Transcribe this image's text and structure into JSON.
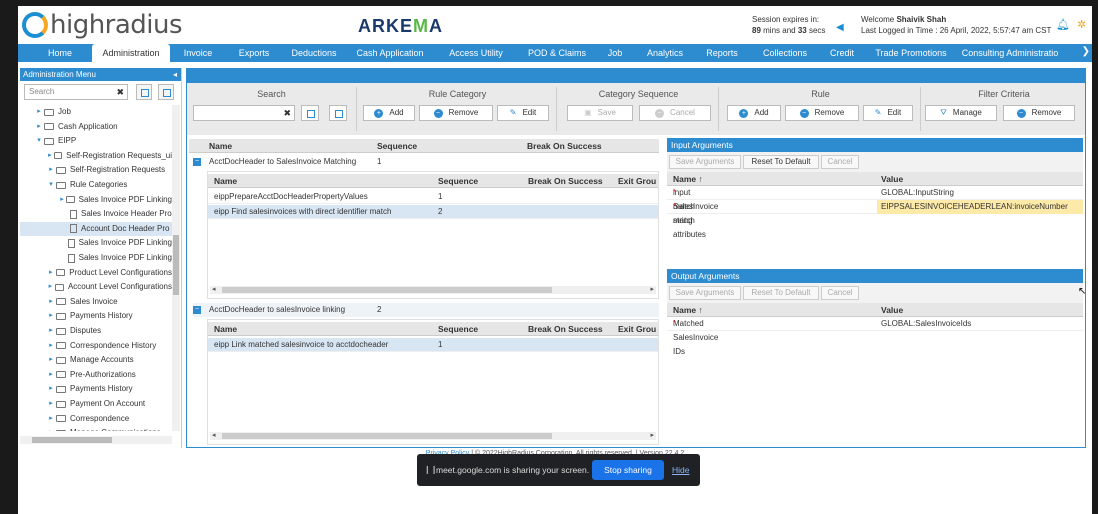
{
  "header": {
    "logo_text": "highradius",
    "brand": "ARKEMA",
    "session_label": "Session expires in:",
    "session_mins": "89",
    "session_mins_label": "mins and",
    "session_secs": "33",
    "session_secs_label": "secs",
    "welcome_label": "Welcome",
    "user_name": "Shaivik Shah",
    "last_logged": "Last Logged in Time : 26 April, 2022, 5:57:47 am CST"
  },
  "nav": {
    "tabs": [
      "Home",
      "Administration",
      "Invoice",
      "Exports",
      "Deductions",
      "Cash Application",
      "Access Utility",
      "POD & Claims",
      "Job",
      "Analytics",
      "Reports",
      "Collections",
      "Credit",
      "Trade Promotions",
      "Consulting Administratio"
    ],
    "active": "Administration"
  },
  "left": {
    "title": "Administration Menu",
    "search_placeholder": "Search",
    "tree": [
      {
        "label": "Job",
        "level": 0,
        "type": "folder",
        "caret": "▸"
      },
      {
        "label": "Cash Application",
        "level": 0,
        "type": "folder",
        "caret": "▸"
      },
      {
        "label": "EIPP",
        "level": 0,
        "type": "folder",
        "caret": "▾"
      },
      {
        "label": "Self-Registration Requests_ui",
        "level": 1,
        "type": "folder",
        "caret": "▸"
      },
      {
        "label": "Self-Registration Requests",
        "level": 1,
        "type": "folder",
        "caret": "▸"
      },
      {
        "label": "Rule Categories",
        "level": 1,
        "type": "folder",
        "caret": "▾"
      },
      {
        "label": "Sales Invoice PDF Linking",
        "level": 2,
        "type": "folder",
        "caret": "▸"
      },
      {
        "label": "Sales Invoice Header Pro",
        "level": 2,
        "type": "file",
        "caret": ""
      },
      {
        "label": "Account Doc Header Pro",
        "level": 2,
        "type": "file",
        "caret": "",
        "selected": true
      },
      {
        "label": "Sales Invoice PDF Linking",
        "level": 2,
        "type": "file",
        "caret": ""
      },
      {
        "label": "Sales Invoice PDF Linking",
        "level": 2,
        "type": "file",
        "caret": ""
      },
      {
        "label": "Product Level Configurations",
        "level": 1,
        "type": "folder",
        "caret": "▸"
      },
      {
        "label": "Account Level Configurations",
        "level": 1,
        "type": "folder",
        "caret": "▸"
      },
      {
        "label": "Sales Invoice",
        "level": 1,
        "type": "folder",
        "caret": "▸"
      },
      {
        "label": "Payments History",
        "level": 1,
        "type": "folder",
        "caret": "▸"
      },
      {
        "label": "Disputes",
        "level": 1,
        "type": "folder",
        "caret": "▸"
      },
      {
        "label": "Correspondence History",
        "level": 1,
        "type": "folder",
        "caret": "▸"
      },
      {
        "label": "Manage Accounts",
        "level": 1,
        "type": "folder",
        "caret": "▸"
      },
      {
        "label": "Pre-Authorizations",
        "level": 1,
        "type": "folder",
        "caret": "▸"
      },
      {
        "label": "Payments History",
        "level": 1,
        "type": "folder",
        "caret": "▸"
      },
      {
        "label": "Payment On Account",
        "level": 1,
        "type": "folder",
        "caret": "▸"
      },
      {
        "label": "Correspondence",
        "level": 1,
        "type": "folder",
        "caret": "▸"
      },
      {
        "label": "Manage Communications",
        "level": 1,
        "type": "folder",
        "caret": "▸"
      }
    ]
  },
  "toolbar": {
    "search_title": "Search",
    "rule_category_title": "Rule Category",
    "rule_category_add": "Add",
    "rule_category_remove": "Remove",
    "rule_category_edit": "Edit",
    "category_sequence_title": "Category Sequence",
    "category_sequence_save": "Save",
    "category_sequence_cancel": "Cancel",
    "rule_title": "Rule",
    "rule_add": "Add",
    "rule_remove": "Remove",
    "rule_edit": "Edit",
    "filter_title": "Filter Criteria",
    "filter_manage": "Manage",
    "filter_remove": "Remove"
  },
  "grid": {
    "headers": [
      "Name",
      "Sequence",
      "Break On Success"
    ],
    "sub_headers": [
      "Name",
      "Sequence",
      "Break On Success",
      "Exit Grou"
    ],
    "groups": [
      {
        "name": "AcctDocHeader to SalesInvoice Matching",
        "sequence": "1",
        "rows": [
          {
            "name": "eippPrepareAcctDocHeaderPropertyValues",
            "sequence": "1",
            "selected": false
          },
          {
            "name": "eipp Find salesinvoices with direct identifier match",
            "sequence": "2",
            "selected": true
          }
        ]
      },
      {
        "name": "AcctDocHeader to salesInvoice linking",
        "sequence": "2",
        "rows": [
          {
            "name": "eipp Link matched salesinvoice to acctdocheader",
            "sequence": "1",
            "selected": true
          }
        ]
      }
    ]
  },
  "input_args": {
    "title": "Input Arguments",
    "save_label": "Save Arguments",
    "reset_label": "Reset To Default",
    "cancel_label": "Cancel",
    "col_name": "Name ↑",
    "col_value": "Value",
    "rows": [
      {
        "name": "input match string",
        "value": "GLOBAL:InputString",
        "highlight": false
      },
      {
        "name": "SalesInvoice match attributes",
        "value": "EIPPSALESINVOICEHEADERLEAN:invoiceNumber",
        "highlight": true
      }
    ]
  },
  "output_args": {
    "title": "Output Arguments",
    "save_label": "Save Arguments",
    "reset_label": "Reset To Default",
    "cancel_label": "Cancel",
    "col_name": "Name ↑",
    "col_value": "Value",
    "rows": [
      {
        "name": "Matched SalesInvoice IDs",
        "value": "GLOBAL:SalesInvoiceIds",
        "highlight": false
      }
    ]
  },
  "footer": {
    "privacy": "Privacy Policy",
    "text": "| © 2022HighRadius Corporation. All rights reserved. | Version 22.4.2"
  },
  "share_bar": {
    "message": "meet.google.com is sharing your screen.",
    "stop": "Stop sharing",
    "hide": "Hide"
  },
  "colors": {
    "primary": "#2d8bd0",
    "accent": "#f5a623",
    "highlight": "#fde9a8"
  }
}
